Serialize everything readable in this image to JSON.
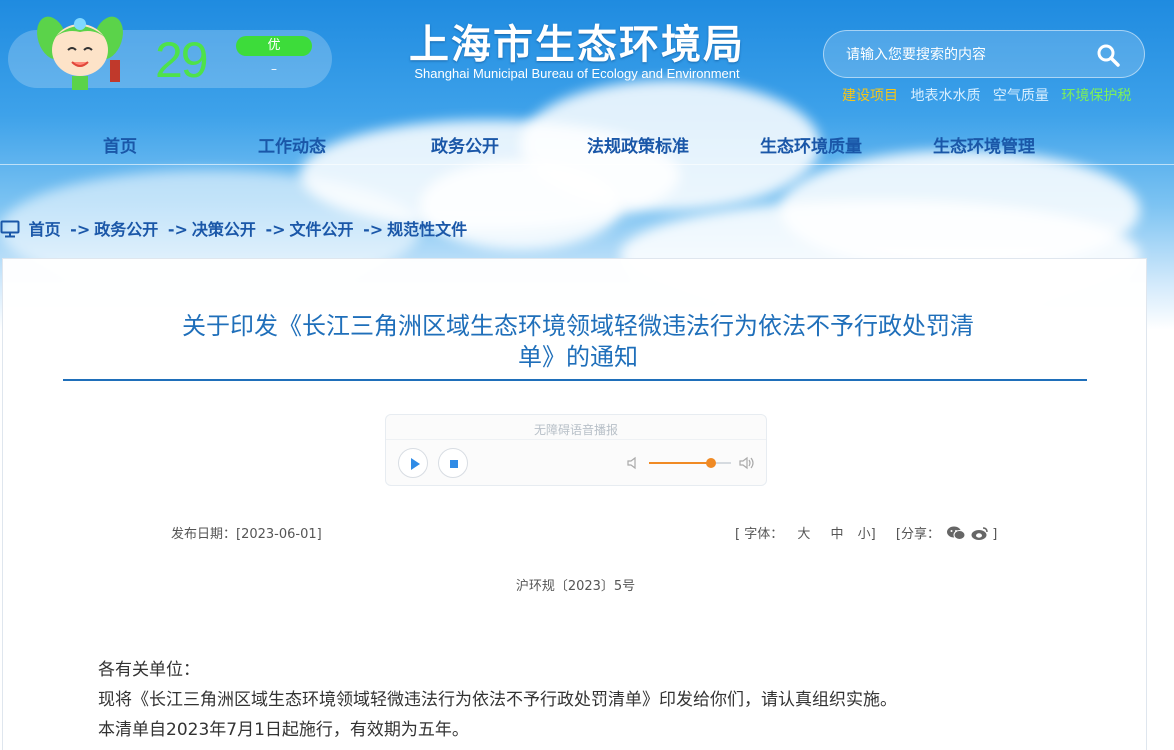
{
  "weather": {
    "temperature": "29",
    "aqi_level": "优",
    "aqi_sub": "–",
    "aqi_color": "#3ddc3a"
  },
  "header": {
    "title": "上海市生态环境局",
    "subtitle": "Shanghai Municipal Bureau of Ecology and Environment"
  },
  "search": {
    "placeholder": "请输入您要搜索的内容",
    "icon": "search-icon"
  },
  "quick_links": [
    {
      "label": "建设项目",
      "color": "#f5c518"
    },
    {
      "label": "地表水水质",
      "color": "#d8efff"
    },
    {
      "label": "空气质量",
      "color": "#d8efff"
    },
    {
      "label": "环境保护税",
      "color": "#7cf05a"
    }
  ],
  "nav": [
    "首页",
    "工作动态",
    "政务公开",
    "法规政策标准",
    "生态环境质量",
    "生态环境管理"
  ],
  "breadcrumb": {
    "icon": "monitor-icon",
    "items": [
      "首页",
      "政务公开",
      "决策公开",
      "文件公开",
      "规范性文件"
    ],
    "separator": "->"
  },
  "article": {
    "title_line1": "关于印发《长江三角洲区域生态环境领域轻微违法行为依法不予行政处罚清",
    "title_line2": "单》的通知",
    "audio_label": "无障碍语音播报",
    "volume_level": 0.75,
    "publish_label": "发布日期：",
    "publish_date": "[2023-06-01]",
    "font_label": "[ 字体：",
    "font_large": "大",
    "font_medium": "中",
    "font_small": "小]",
    "share_label": "[分享：",
    "share_end": "]",
    "doc_number": "沪环规〔2023〕5号",
    "body": [
      "各有关单位：",
      "现将《长江三角洲区域生态环境领域轻微违法行为依法不予行政处罚清单》印发给你们，请认真组织实施。",
      "本清单自2023年7月1日起施行，有效期为五年。"
    ]
  }
}
